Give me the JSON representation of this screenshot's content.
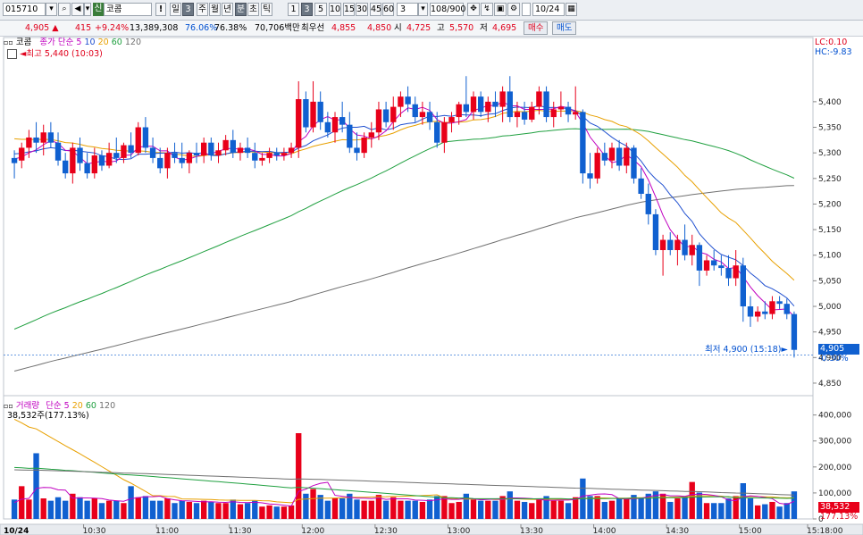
{
  "toolbar": {
    "code": "015710",
    "name_badge": "신",
    "name": "코콤",
    "warn": "!",
    "periods": [
      "일",
      "3",
      "주",
      "월",
      "년",
      "분",
      "초",
      "틱"
    ],
    "minutes": [
      "1",
      "3",
      "5",
      "10",
      "15",
      "30",
      "45",
      "60"
    ],
    "interval_value": "3",
    "count": "108/900",
    "date": "10/24"
  },
  "quote": {
    "price": "4,905 ▲",
    "change": "415",
    "change_pct": "+9.24%",
    "volume": "13,389,308",
    "ratio1": "76.06%",
    "ratio2": "76.38%",
    "amount": "70,706백만",
    "ask_label": "최우선",
    "ask": "4,855",
    "bid": "4,850",
    "open_label": "시",
    "open": "4,725",
    "high_label": "고",
    "high": "5,570",
    "low_label": "저",
    "low": "4,695",
    "buy": "매수",
    "sell": "매도"
  },
  "price_panel": {
    "title": "코콤",
    "ma_label": "종가 단순",
    "ma_periods": [
      "5",
      "10",
      "20",
      "60",
      "120"
    ],
    "high_note": "최고 5,440 (10:03)",
    "low_note": "최저 4,900 (15:18)",
    "lc": "LC:0.10",
    "hc": "HC:-9.83",
    "current": "4,905",
    "current_pct": "-0.30%"
  },
  "volume_panel": {
    "title": "거래량",
    "ma_label": "단순",
    "ma_periods": [
      "5",
      "20",
      "60",
      "120"
    ],
    "readout": "38,532주(177.13%)",
    "current": "38,532",
    "current_pct": "177.13%"
  },
  "chart_data": {
    "type": "candlestick",
    "price_axis": {
      "ticks": [
        "5,400",
        "5,350",
        "5,300",
        "5,250",
        "5,200",
        "5,150",
        "5,100",
        "5,050",
        "5,000",
        "4,950",
        "4,900",
        "4,850"
      ],
      "ylim": [
        4822,
        5515
      ]
    },
    "volume_axis": {
      "ticks": [
        "400,000",
        "300,000",
        "200,000",
        "100,000",
        "0"
      ],
      "ylim": [
        0,
        440000
      ]
    },
    "time_axis": {
      "first": "10/24",
      "ticks": [
        "10:30",
        "11:00",
        "11:30",
        "12:00",
        "12:30",
        "13:00",
        "13:30",
        "14:00",
        "14:30",
        "15:00",
        "15:18:00"
      ]
    },
    "candles": [
      [
        5290,
        5305,
        5250,
        5280
      ],
      [
        5285,
        5320,
        5270,
        5310
      ],
      [
        5310,
        5345,
        5290,
        5330
      ],
      [
        5330,
        5360,
        5300,
        5320
      ],
      [
        5320,
        5355,
        5295,
        5340
      ],
      [
        5340,
        5360,
        5310,
        5320
      ],
      [
        5320,
        5340,
        5275,
        5285
      ],
      [
        5285,
        5300,
        5250,
        5260
      ],
      [
        5260,
        5320,
        5240,
        5310
      ],
      [
        5310,
        5330,
        5265,
        5280
      ],
      [
        5280,
        5300,
        5250,
        5260
      ],
      [
        5260,
        5310,
        5250,
        5295
      ],
      [
        5295,
        5305,
        5265,
        5275
      ],
      [
        5275,
        5320,
        5270,
        5300
      ],
      [
        5300,
        5330,
        5280,
        5290
      ],
      [
        5290,
        5320,
        5280,
        5315
      ],
      [
        5315,
        5340,
        5290,
        5300
      ],
      [
        5300,
        5360,
        5295,
        5350
      ],
      [
        5350,
        5370,
        5300,
        5310
      ],
      [
        5310,
        5330,
        5280,
        5290
      ],
      [
        5290,
        5310,
        5260,
        5270
      ],
      [
        5270,
        5310,
        5250,
        5300
      ],
      [
        5300,
        5320,
        5280,
        5290
      ],
      [
        5290,
        5320,
        5270,
        5280
      ],
      [
        5280,
        5305,
        5260,
        5300
      ],
      [
        5300,
        5320,
        5280,
        5295
      ],
      [
        5295,
        5330,
        5280,
        5320
      ],
      [
        5320,
        5330,
        5285,
        5295
      ],
      [
        5295,
        5320,
        5280,
        5305
      ],
      [
        5305,
        5335,
        5295,
        5325
      ],
      [
        5325,
        5345,
        5290,
        5300
      ],
      [
        5300,
        5320,
        5285,
        5310
      ],
      [
        5310,
        5330,
        5290,
        5300
      ],
      [
        5300,
        5320,
        5270,
        5285
      ],
      [
        5285,
        5300,
        5275,
        5290
      ],
      [
        5290,
        5310,
        5280,
        5300
      ],
      [
        5300,
        5310,
        5285,
        5295
      ],
      [
        5295,
        5310,
        5285,
        5300
      ],
      [
        5300,
        5320,
        5290,
        5310
      ],
      [
        5310,
        5440,
        5290,
        5405
      ],
      [
        5405,
        5420,
        5340,
        5350
      ],
      [
        5350,
        5440,
        5340,
        5400
      ],
      [
        5400,
        5420,
        5345,
        5360
      ],
      [
        5360,
        5380,
        5330,
        5340
      ],
      [
        5340,
        5380,
        5320,
        5370
      ],
      [
        5370,
        5400,
        5340,
        5355
      ],
      [
        5355,
        5380,
        5300,
        5310
      ],
      [
        5310,
        5340,
        5285,
        5300
      ],
      [
        5300,
        5340,
        5290,
        5330
      ],
      [
        5330,
        5360,
        5310,
        5340
      ],
      [
        5340,
        5400,
        5325,
        5385
      ],
      [
        5385,
        5400,
        5350,
        5360
      ],
      [
        5360,
        5410,
        5345,
        5390
      ],
      [
        5390,
        5420,
        5370,
        5410
      ],
      [
        5410,
        5430,
        5380,
        5395
      ],
      [
        5395,
        5410,
        5360,
        5370
      ],
      [
        5370,
        5400,
        5355,
        5380
      ],
      [
        5380,
        5400,
        5345,
        5360
      ],
      [
        5360,
        5380,
        5310,
        5320
      ],
      [
        5320,
        5370,
        5300,
        5360
      ],
      [
        5360,
        5380,
        5340,
        5370
      ],
      [
        5370,
        5400,
        5355,
        5395
      ],
      [
        5395,
        5450,
        5370,
        5380
      ],
      [
        5380,
        5420,
        5365,
        5410
      ],
      [
        5410,
        5420,
        5370,
        5380
      ],
      [
        5380,
        5410,
        5360,
        5400
      ],
      [
        5400,
        5420,
        5370,
        5390
      ],
      [
        5390,
        5430,
        5360,
        5420
      ],
      [
        5420,
        5450,
        5360,
        5370
      ],
      [
        5370,
        5400,
        5350,
        5380
      ],
      [
        5380,
        5400,
        5355,
        5365
      ],
      [
        5365,
        5400,
        5360,
        5390
      ],
      [
        5390,
        5430,
        5375,
        5420
      ],
      [
        5420,
        5430,
        5360,
        5370
      ],
      [
        5370,
        5400,
        5350,
        5385
      ],
      [
        5385,
        5420,
        5370,
        5390
      ],
      [
        5390,
        5400,
        5360,
        5375
      ],
      [
        5375,
        5430,
        5365,
        5380
      ],
      [
        5380,
        5385,
        5240,
        5260
      ],
      [
        5260,
        5300,
        5230,
        5250
      ],
      [
        5250,
        5310,
        5240,
        5300
      ],
      [
        5300,
        5320,
        5275,
        5285
      ],
      [
        5285,
        5320,
        5270,
        5310
      ],
      [
        5310,
        5325,
        5265,
        5275
      ],
      [
        5275,
        5320,
        5260,
        5310
      ],
      [
        5310,
        5315,
        5240,
        5250
      ],
      [
        5250,
        5270,
        5210,
        5220
      ],
      [
        5220,
        5240,
        5160,
        5180
      ],
      [
        5180,
        5190,
        5100,
        5110
      ],
      [
        5110,
        5140,
        5060,
        5130
      ],
      [
        5130,
        5145,
        5100,
        5110
      ],
      [
        5110,
        5140,
        5080,
        5130
      ],
      [
        5130,
        5160,
        5090,
        5100
      ],
      [
        5100,
        5140,
        5080,
        5120
      ],
      [
        5120,
        5125,
        5040,
        5070
      ],
      [
        5070,
        5100,
        5060,
        5090
      ],
      [
        5090,
        5110,
        5070,
        5080
      ],
      [
        5080,
        5100,
        5060,
        5075
      ],
      [
        5075,
        5100,
        5040,
        5055
      ],
      [
        5055,
        5110,
        5040,
        5080
      ],
      [
        5080,
        5095,
        4970,
        5000
      ],
      [
        5000,
        5020,
        4960,
        4980
      ],
      [
        4980,
        5000,
        4970,
        4990
      ],
      [
        4990,
        5010,
        4975,
        4985
      ],
      [
        4985,
        5020,
        4975,
        5010
      ],
      [
        5010,
        5020,
        4995,
        5005
      ],
      [
        5005,
        5015,
        4975,
        4985
      ],
      [
        4985,
        4990,
        4900,
        4915
      ]
    ],
    "ma5_color": "#c000c0",
    "ma10_color": "#2050d0",
    "ma20_color": "#e8a000",
    "ma60_color": "#20a040",
    "ma120_color": "#707070",
    "up_color": "#e8001a",
    "down_color": "#1060d0"
  }
}
